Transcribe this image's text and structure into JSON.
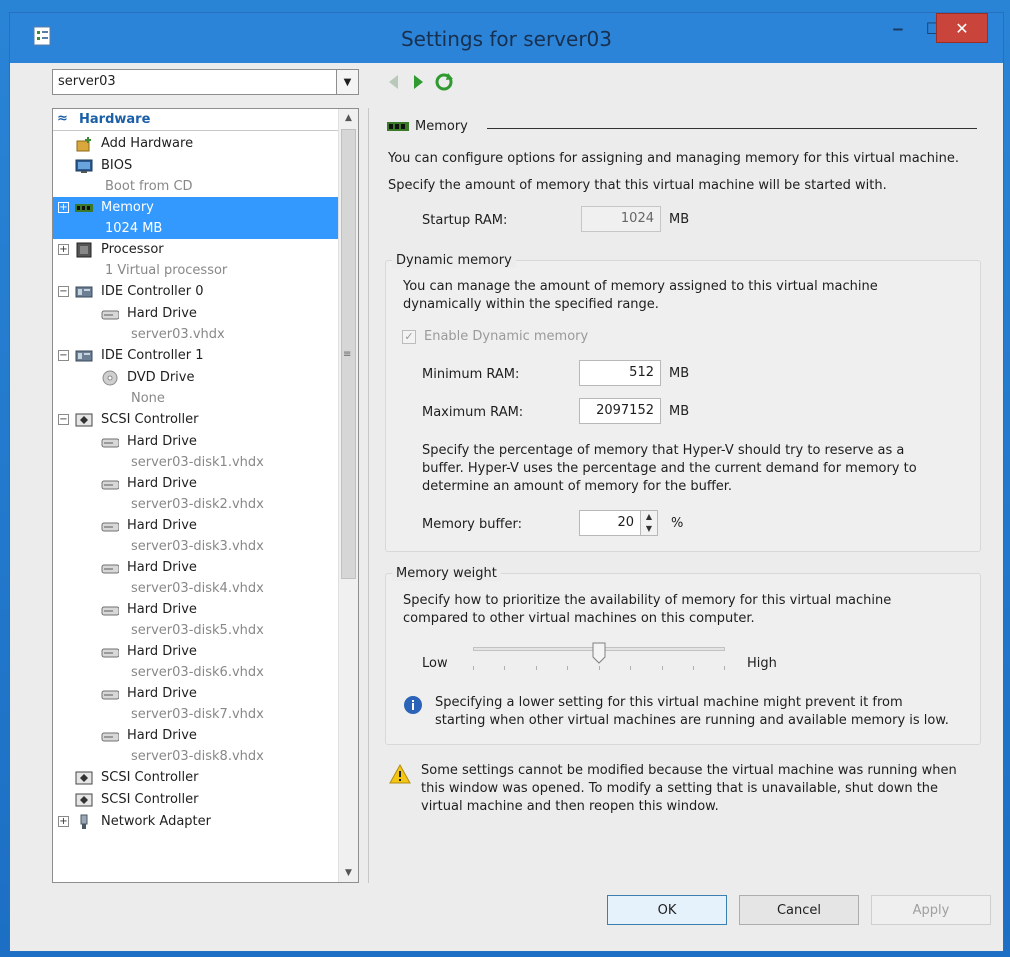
{
  "window": {
    "title": "Settings for server03",
    "minimize_label": "‒",
    "maximize_label": "☐",
    "close_label": "✕"
  },
  "vm_selector": {
    "value": "server03"
  },
  "tree": {
    "header": "Hardware",
    "items": [
      {
        "label": "Add Hardware",
        "icon": "add-hardware-icon"
      },
      {
        "label": "BIOS",
        "sub": "Boot from CD",
        "icon": "bios-icon"
      },
      {
        "label": "Memory",
        "sub": "1024 MB",
        "icon": "memory-icon",
        "selected": true,
        "expander": "+"
      },
      {
        "label": "Processor",
        "sub": "1 Virtual processor",
        "icon": "processor-icon",
        "expander": "+"
      },
      {
        "label": "IDE Controller 0",
        "icon": "ide-controller-icon",
        "expander": "−"
      },
      {
        "label": "Hard Drive",
        "sub": "server03.vhdx",
        "icon": "hard-drive-icon"
      },
      {
        "label": "IDE Controller 1",
        "icon": "ide-controller-icon",
        "expander": "−"
      },
      {
        "label": "DVD Drive",
        "sub": "None",
        "icon": "dvd-drive-icon"
      },
      {
        "label": "SCSI Controller",
        "icon": "scsi-controller-icon",
        "expander": "−"
      },
      {
        "label": "Hard Drive",
        "sub": "server03-disk1.vhdx",
        "icon": "hard-drive-icon"
      },
      {
        "label": "Hard Drive",
        "sub": "server03-disk2.vhdx",
        "icon": "hard-drive-icon"
      },
      {
        "label": "Hard Drive",
        "sub": "server03-disk3.vhdx",
        "icon": "hard-drive-icon"
      },
      {
        "label": "Hard Drive",
        "sub": "server03-disk4.vhdx",
        "icon": "hard-drive-icon"
      },
      {
        "label": "Hard Drive",
        "sub": "server03-disk5.vhdx",
        "icon": "hard-drive-icon"
      },
      {
        "label": "Hard Drive",
        "sub": "server03-disk6.vhdx",
        "icon": "hard-drive-icon"
      },
      {
        "label": "Hard Drive",
        "sub": "server03-disk7.vhdx",
        "icon": "hard-drive-icon"
      },
      {
        "label": "Hard Drive",
        "sub": "server03-disk8.vhdx",
        "icon": "hard-drive-icon"
      },
      {
        "label": "SCSI Controller",
        "icon": "scsi-controller-icon"
      },
      {
        "label": "SCSI Controller",
        "icon": "scsi-controller-icon"
      },
      {
        "label": "Network Adapter",
        "icon": "network-adapter-icon",
        "expander": "+"
      }
    ]
  },
  "memory": {
    "section_title": "Memory",
    "intro": "You can configure options for assigning and managing memory for this virtual machine.",
    "startup_hint": "Specify the amount of memory that this virtual machine will be started with.",
    "startup_label": "Startup RAM:",
    "startup_value": "1024",
    "unit_mb": "MB",
    "dynamic": {
      "title": "Dynamic memory",
      "desc_line1": "You can manage the amount of memory assigned to this virtual machine",
      "desc_line2": "dynamically within the specified range.",
      "enable_label": "Enable Dynamic memory",
      "enable_checked": true,
      "min_label": "Minimum RAM:",
      "min_value": "512",
      "max_label": "Maximum RAM:",
      "max_value": "2097152",
      "buffer_text_1": "Specify the percentage of memory that Hyper-V should try to reserve as a",
      "buffer_text_2": "buffer. Hyper-V uses the percentage and the current demand for memory to",
      "buffer_text_3": "determine an amount of memory for the buffer.",
      "buffer_label": "Memory buffer:",
      "buffer_value": "20",
      "buffer_unit": "%"
    },
    "weight": {
      "title": "Memory weight",
      "desc_line1": "Specify how to prioritize the availability of memory for this virtual machine",
      "desc_line2": "compared to other virtual machines on this computer.",
      "low_label": "Low",
      "high_label": "High",
      "slider_level": 0.5,
      "info_line1": "Specifying a lower setting for this virtual machine might prevent it from",
      "info_line2": "starting when other virtual machines are running and available memory is low."
    },
    "warning_line1": "Some settings cannot be modified because the virtual machine was running when",
    "warning_line2": "this window was opened. To modify a setting that is unavailable, shut down the",
    "warning_line3": "virtual machine and then reopen this window."
  },
  "buttons": {
    "ok": "OK",
    "cancel": "Cancel",
    "apply": "Apply"
  },
  "colors": {
    "selection": "#3399ff",
    "titlebar": "#2b84d8",
    "close": "#c9443a"
  }
}
